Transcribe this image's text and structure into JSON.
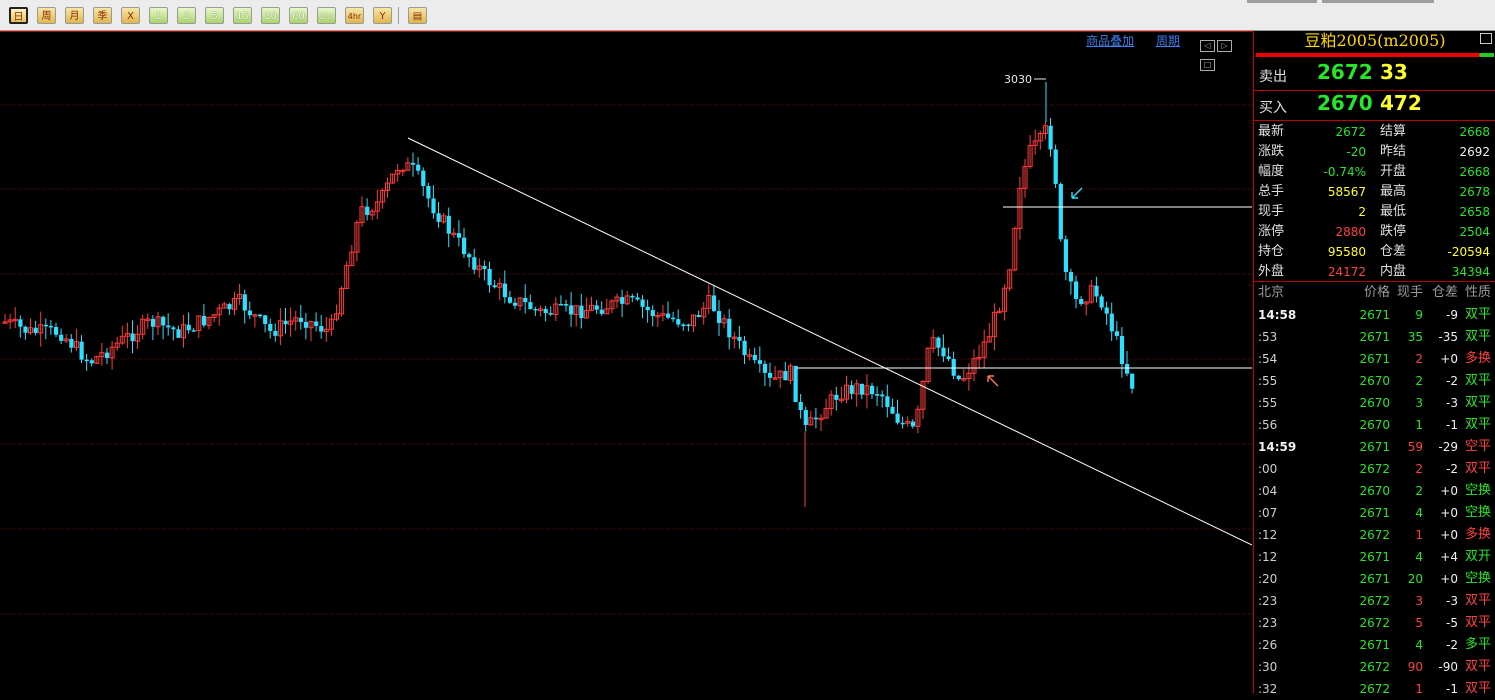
{
  "toolbar": {
    "buttons": [
      "日",
      "周",
      "月",
      "季",
      "X",
      "1",
      "3",
      "5",
      "15",
      "30",
      "60",
      "2hr",
      "4hr",
      "Y"
    ],
    "active": "日",
    "extra_icon": "chart-settings-icon"
  },
  "chart": {
    "links": {
      "overlay": "商品叠加",
      "period": "周期"
    },
    "peak_label": "3030",
    "peak_value": 3030,
    "colors": {
      "up": "#ff3b3b",
      "down": "#2de0ff",
      "grid": "#7a0000",
      "trendline": "#ffffff"
    }
  },
  "quote": {
    "title": "豆粕2005(m2005)",
    "ask": {
      "label": "卖出",
      "price": "2672",
      "vol": "33"
    },
    "bid": {
      "label": "买入",
      "price": "2670",
      "vol": "472"
    },
    "stats": [
      {
        "k": "最新",
        "v": "2672",
        "c": "green",
        "k2": "结算",
        "v2": "2668",
        "c2": "green"
      },
      {
        "k": "涨跌",
        "v": "-20",
        "c": "green",
        "k2": "昨结",
        "v2": "2692",
        "c2": "white"
      },
      {
        "k": "幅度",
        "v": "-0.74%",
        "c": "green",
        "k2": "开盘",
        "v2": "2668",
        "c2": "green"
      },
      {
        "k": "总手",
        "v": "58567",
        "c": "yellow",
        "k2": "最高",
        "v2": "2678",
        "c2": "green"
      },
      {
        "k": "现手",
        "v": "2",
        "c": "yellow",
        "k2": "最低",
        "v2": "2658",
        "c2": "green"
      },
      {
        "k": "涨停",
        "v": "2880",
        "c": "red",
        "k2": "跌停",
        "v2": "2504",
        "c2": "green"
      },
      {
        "k": "持仓",
        "v": "95580",
        "c": "yellow",
        "k2": "仓差",
        "v2": "-20594",
        "c2": "yellow"
      },
      {
        "k": "外盘",
        "v": "24172",
        "c": "red",
        "k2": "内盘",
        "v2": "34394",
        "c2": "green"
      }
    ],
    "tick_headers": {
      "time": "北京",
      "price": "价格",
      "vol": "现手",
      "oi": "仓差",
      "type": "性质"
    },
    "ticks": [
      {
        "t": "14:58",
        "p": "2671",
        "pc": "green",
        "v": "9",
        "vc": "green",
        "o": "-9",
        "ty": "双平",
        "tc": "green"
      },
      {
        "t": ":53",
        "p": "2671",
        "pc": "green",
        "v": "35",
        "vc": "green",
        "o": "-35",
        "ty": "双平",
        "tc": "green"
      },
      {
        "t": ":54",
        "p": "2671",
        "pc": "green",
        "v": "2",
        "vc": "red",
        "o": "+0",
        "ty": "多换",
        "tc": "red"
      },
      {
        "t": ":55",
        "p": "2670",
        "pc": "green",
        "v": "2",
        "vc": "green",
        "o": "-2",
        "ty": "双平",
        "tc": "green"
      },
      {
        "t": ":55",
        "p": "2670",
        "pc": "green",
        "v": "3",
        "vc": "green",
        "o": "-3",
        "ty": "双平",
        "tc": "green"
      },
      {
        "t": ":56",
        "p": "2670",
        "pc": "green",
        "v": "1",
        "vc": "green",
        "o": "-1",
        "ty": "双平",
        "tc": "green"
      },
      {
        "t": "14:59",
        "p": "2671",
        "pc": "green",
        "v": "59",
        "vc": "red",
        "o": "-29",
        "ty": "空平",
        "tc": "red"
      },
      {
        "t": ":00",
        "p": "2672",
        "pc": "green",
        "v": "2",
        "vc": "red",
        "o": "-2",
        "ty": "双平",
        "tc": "red"
      },
      {
        "t": ":04",
        "p": "2670",
        "pc": "green",
        "v": "2",
        "vc": "green",
        "o": "+0",
        "ty": "空换",
        "tc": "green"
      },
      {
        "t": ":07",
        "p": "2671",
        "pc": "green",
        "v": "4",
        "vc": "green",
        "o": "+0",
        "ty": "空换",
        "tc": "green"
      },
      {
        "t": ":12",
        "p": "2672",
        "pc": "green",
        "v": "1",
        "vc": "red",
        "o": "+0",
        "ty": "多换",
        "tc": "red"
      },
      {
        "t": ":12",
        "p": "2671",
        "pc": "green",
        "v": "4",
        "vc": "green",
        "o": "+4",
        "ty": "双开",
        "tc": "green"
      },
      {
        "t": ":20",
        "p": "2671",
        "pc": "green",
        "v": "20",
        "vc": "green",
        "o": "+0",
        "ty": "空换",
        "tc": "green"
      },
      {
        "t": ":23",
        "p": "2672",
        "pc": "green",
        "v": "3",
        "vc": "red",
        "o": "-3",
        "ty": "双平",
        "tc": "red"
      },
      {
        "t": ":23",
        "p": "2672",
        "pc": "green",
        "v": "5",
        "vc": "red",
        "o": "-5",
        "ty": "双平",
        "tc": "red"
      },
      {
        "t": ":26",
        "p": "2671",
        "pc": "green",
        "v": "4",
        "vc": "green",
        "o": "-2",
        "ty": "多平",
        "tc": "green"
      },
      {
        "t": ":30",
        "p": "2672",
        "pc": "green",
        "v": "90",
        "vc": "red",
        "o": "-90",
        "ty": "双平",
        "tc": "red"
      },
      {
        "t": ":32",
        "p": "2672",
        "pc": "green",
        "v": "1",
        "vc": "red",
        "o": "-1",
        "ty": "双平",
        "tc": "red"
      }
    ]
  }
}
